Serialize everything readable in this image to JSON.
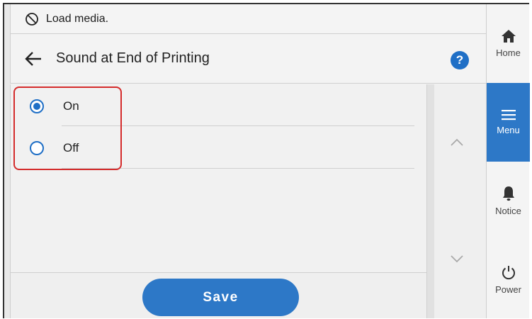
{
  "status": {
    "message": "Load media.",
    "icon": "no-media-icon"
  },
  "header": {
    "title": "Sound at End of Printing",
    "back_icon": "back-arrow-icon",
    "help_label": "?"
  },
  "options": [
    {
      "label": "On",
      "checked": true
    },
    {
      "label": "Off",
      "checked": false
    }
  ],
  "footer": {
    "save_label": "Save"
  },
  "nav": {
    "home": "Home",
    "menu": "Menu",
    "notice": "Notice",
    "power": "Power"
  },
  "colors": {
    "accent": "#2d78c7",
    "highlight": "#d42b2b"
  }
}
